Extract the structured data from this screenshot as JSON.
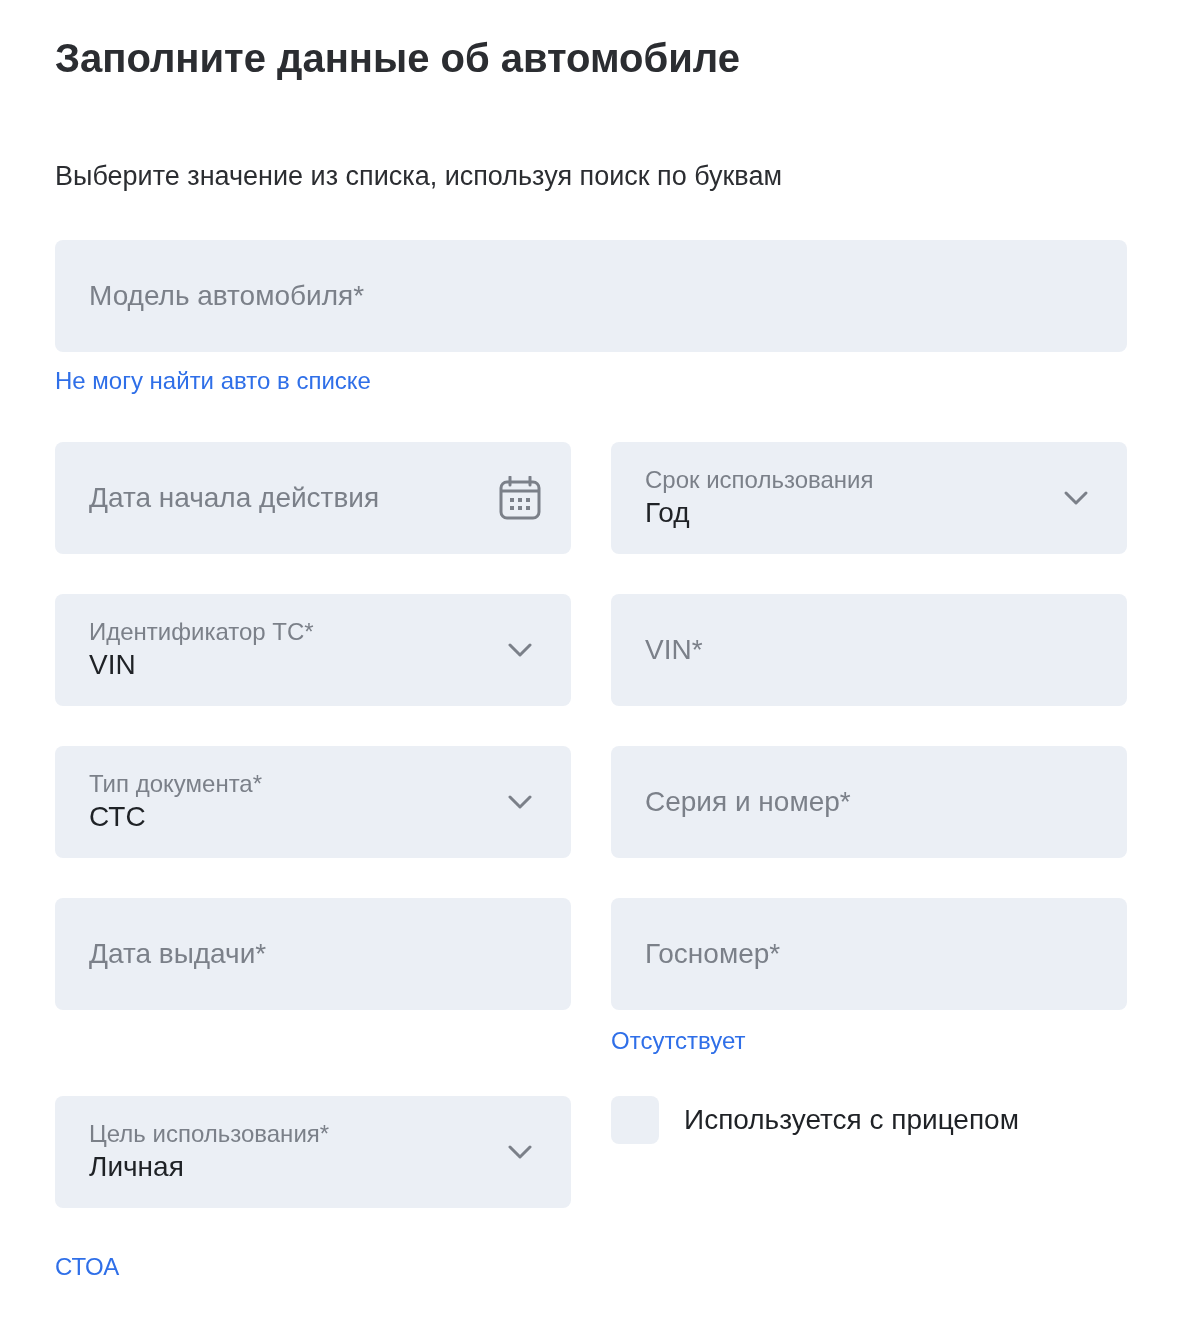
{
  "title": "Заполните данные об автомобиле",
  "subtitle": "Выберите значение из списка, используя поиск по буквам",
  "model_field": {
    "placeholder": "Модель автомобиля*"
  },
  "model_link": "Не могу найти авто в списке",
  "rows": [
    [
      {
        "kind": "date",
        "placeholder": "Дата начала действия"
      },
      {
        "kind": "select",
        "label": "Срок использования",
        "value": "Год"
      }
    ],
    [
      {
        "kind": "select",
        "label": "Идентификатор ТС*",
        "value": "VIN"
      },
      {
        "kind": "text",
        "placeholder": "VIN*"
      }
    ],
    [
      {
        "kind": "select",
        "label": "Тип документа*",
        "value": "СТС"
      },
      {
        "kind": "text",
        "placeholder": "Серия и номер*"
      }
    ],
    [
      {
        "kind": "text",
        "placeholder": "Дата выдачи*"
      },
      {
        "kind": "text",
        "placeholder": "Госномер*",
        "link": "Отсутствует"
      }
    ],
    [
      {
        "kind": "select",
        "label": "Цель использования*",
        "value": "Личная"
      },
      {
        "kind": "checkbox",
        "label": "Используется с прицепом",
        "checked": false
      }
    ]
  ],
  "bottom_link": "СТОА"
}
